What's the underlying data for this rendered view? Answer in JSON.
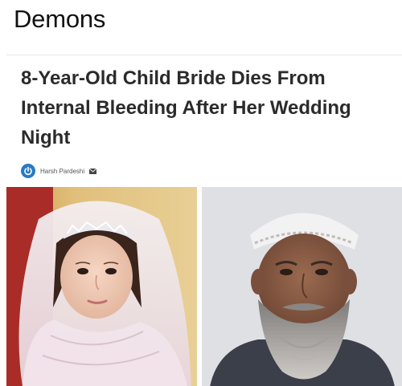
{
  "caption": "Demons",
  "article": {
    "headline": "8-Year-Old Child Bride Dies From Internal Bleeding After Her Wedding Night",
    "author": "Harsh Pardeshi",
    "colors": {
      "headline": "#2b2b2b",
      "logo": "#2a7ac4"
    },
    "icons": [
      "power-logo-icon",
      "envelope-icon"
    ]
  },
  "photos": [
    {
      "subject": "girl-in-veil-photo"
    },
    {
      "subject": "bearded-man-photo"
    }
  ]
}
